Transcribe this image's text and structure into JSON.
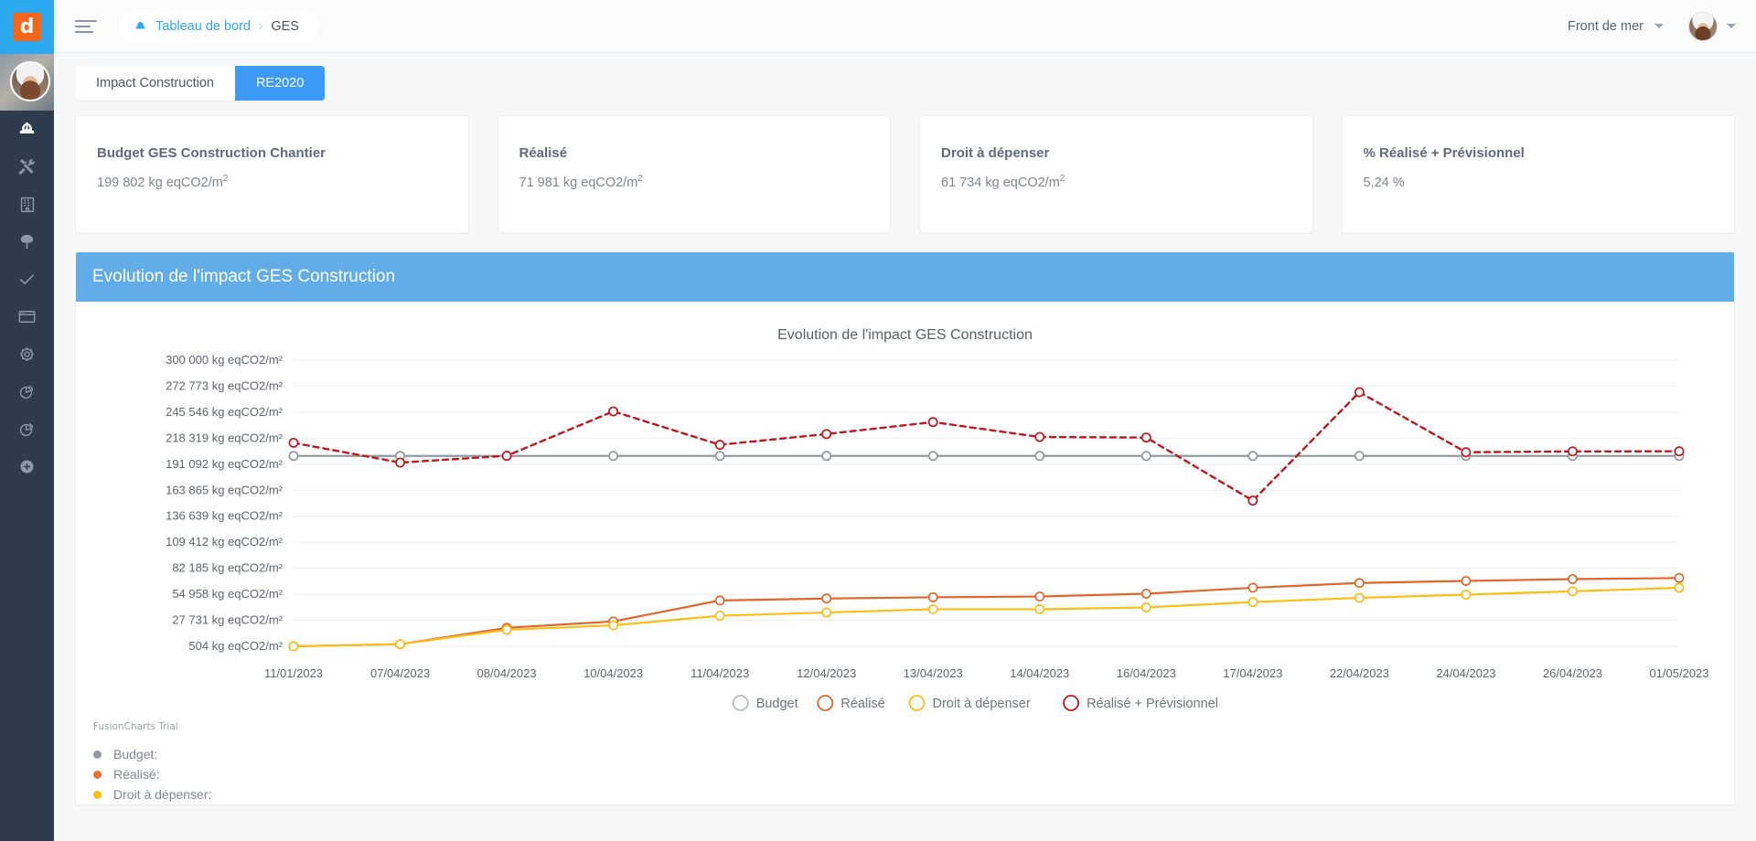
{
  "brand": {
    "logo_letter": "d"
  },
  "topbar": {
    "breadcrumb": {
      "icon": "hard-hat-icon",
      "root": "Tableau de bord",
      "separator": "›",
      "current": "GES"
    },
    "project_selector": {
      "value": "Front de mer"
    },
    "menu_icon": "hamburger-icon",
    "user_caret": "chevron-down-icon"
  },
  "sidebar": {
    "items": [
      {
        "icon": "hard-hat-icon",
        "active": true
      },
      {
        "icon": "tools-icon",
        "active": false
      },
      {
        "icon": "building-icon",
        "active": false
      },
      {
        "icon": "tree-icon",
        "active": false
      },
      {
        "icon": "check-icon",
        "active": false
      },
      {
        "icon": "window-icon",
        "active": false
      },
      {
        "icon": "gear-icon",
        "active": false
      },
      {
        "icon": "pie-chart-icon",
        "active": false
      },
      {
        "icon": "pie-chart-alt-icon",
        "active": false
      },
      {
        "icon": "plus-circle-icon",
        "active": false
      }
    ]
  },
  "tabs": [
    {
      "label": "Impact Construction",
      "active": false
    },
    {
      "label": "RE2020",
      "active": true
    }
  ],
  "kpis": [
    {
      "title": "Budget GES Construction Chantier",
      "value": "199 802 kg eqCO2/m",
      "sup": "2"
    },
    {
      "title": "Réalisé",
      "value": "71 981 kg eqCO2/m",
      "sup": "2"
    },
    {
      "title": "Droit à dépenser",
      "value": "61 734 kg eqCO2/m",
      "sup": "2"
    },
    {
      "title": "% Réalisé + Prévisionnel",
      "value": "5,24 %",
      "sup": ""
    }
  ],
  "panel": {
    "header": "Evolution de l'impact GES Construction",
    "watermark": "FusionCharts Trial"
  },
  "tooltip_legend": [
    {
      "label": "Budget:",
      "color": "#919aa3"
    },
    {
      "label": "Réalisé:",
      "color": "#ed6f32"
    },
    {
      "label": "Droit à dépenser:",
      "color": "#fbbe17"
    }
  ],
  "colors": {
    "accent_blue": "#3d9bf7",
    "panel_blue": "#62ade8",
    "sidebar": "#2e3b4e",
    "budget": "#919aa3",
    "realise": "#e2662a",
    "droit": "#fbbe17",
    "previsionnel": "#c0171d"
  },
  "chart_data": {
    "type": "line",
    "title": "Evolution de l'impact GES Construction",
    "xlabel": "",
    "ylabel": "",
    "grid": true,
    "legend_position": "bottom",
    "ylim": [
      504,
      300000
    ],
    "ytick_labels": [
      "300 000 kg eqCO2/m²",
      "272 773 kg eqCO2/m²",
      "245 546 kg eqCO2/m²",
      "218 319 kg eqCO2/m²",
      "191 092 kg eqCO2/m²",
      "163 865 kg eqCO2/m²",
      "136 639 kg eqCO2/m²",
      "109 412 kg eqCO2/m²",
      "82 185 kg eqCO2/m²",
      "54 958 kg eqCO2/m²",
      "27 731 kg eqCO2/m²",
      "504 kg eqCO2/m²"
    ],
    "ytick_values": [
      300000,
      272773,
      245546,
      218319,
      191092,
      163865,
      136639,
      109412,
      82185,
      54958,
      27731,
      504
    ],
    "categories": [
      "11/01/2023",
      "07/04/2023",
      "08/04/2023",
      "10/04/2023",
      "11/04/2023",
      "12/04/2023",
      "13/04/2023",
      "14/04/2023",
      "16/04/2023",
      "17/04/2023",
      "22/04/2023",
      "24/04/2023",
      "26/04/2023",
      "01/05/2023"
    ],
    "series": [
      {
        "name": "Budget",
        "color": "#919aa3",
        "style": "solid",
        "values": [
          199802,
          199802,
          199802,
          199802,
          199802,
          199802,
          199802,
          199802,
          199802,
          199802,
          199802,
          199802,
          199802,
          199802
        ]
      },
      {
        "name": "Réalisé",
        "color": "#e2662a",
        "style": "solid",
        "values": [
          504,
          2700,
          19800,
          26500,
          48500,
          50500,
          51800,
          52600,
          55500,
          61800,
          66800,
          68900,
          70800,
          71981
        ]
      },
      {
        "name": "Droit à dépenser",
        "color": "#fbbe17",
        "style": "solid",
        "values": [
          504,
          2700,
          17800,
          22400,
          32500,
          35900,
          39300,
          39300,
          41200,
          46800,
          51200,
          54600,
          58000,
          61734
        ]
      },
      {
        "name": "Réalisé + Prévisionnel",
        "color": "#c0171d",
        "style": "dashed",
        "values": [
          213500,
          192800,
          199900,
          246400,
          211400,
          222700,
          235200,
          219600,
          219000,
          153000,
          266500,
          203600,
          204500,
          204600
        ]
      }
    ],
    "legend": [
      {
        "label": "Budget",
        "color": "#b5bcc3"
      },
      {
        "label": "Réalisé",
        "color": "#e2662a"
      },
      {
        "label": "Droit à dépenser",
        "color": "#fbbe17"
      },
      {
        "label": "Réalisé + Prévisionnel",
        "color": "#c0171d"
      }
    ]
  }
}
